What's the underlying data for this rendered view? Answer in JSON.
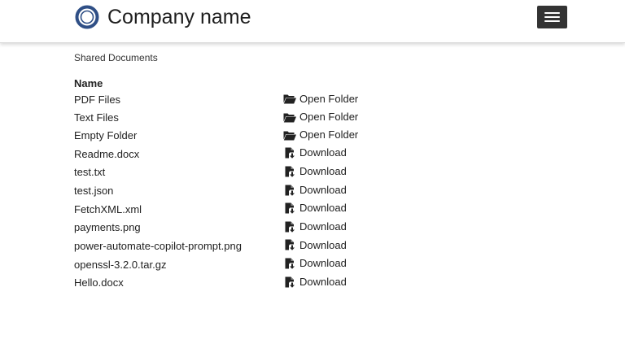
{
  "header": {
    "brand_name": "Company name",
    "logo_icon": "ring-logo-icon",
    "menu_icon": "hamburger-menu-icon"
  },
  "breadcrumb": "Shared Documents",
  "table": {
    "column_name": "Name",
    "rows": [
      {
        "name": "PDF Files",
        "action": "Open Folder",
        "icon": "folder-open-icon"
      },
      {
        "name": "Text Files",
        "action": "Open Folder",
        "icon": "folder-open-icon"
      },
      {
        "name": "Empty Folder",
        "action": "Open Folder",
        "icon": "folder-open-icon"
      },
      {
        "name": "Readme.docx",
        "action": "Download",
        "icon": "file-download-icon"
      },
      {
        "name": "test.txt",
        "action": "Download",
        "icon": "file-download-icon"
      },
      {
        "name": "test.json",
        "action": "Download",
        "icon": "file-download-icon"
      },
      {
        "name": "FetchXML.xml",
        "action": "Download",
        "icon": "file-download-icon"
      },
      {
        "name": "payments.png",
        "action": "Download",
        "icon": "file-download-icon"
      },
      {
        "name": "power-automate-copilot-prompt.png",
        "action": "Download",
        "icon": "file-download-icon"
      },
      {
        "name": "openssl-3.2.0.tar.gz",
        "action": "Download",
        "icon": "file-download-icon"
      },
      {
        "name": "Hello.docx",
        "action": "Download",
        "icon": "file-download-icon"
      }
    ]
  },
  "colors": {
    "logo_ring": "#2f4f86",
    "menu_button": "#333333",
    "text": "#222222"
  }
}
